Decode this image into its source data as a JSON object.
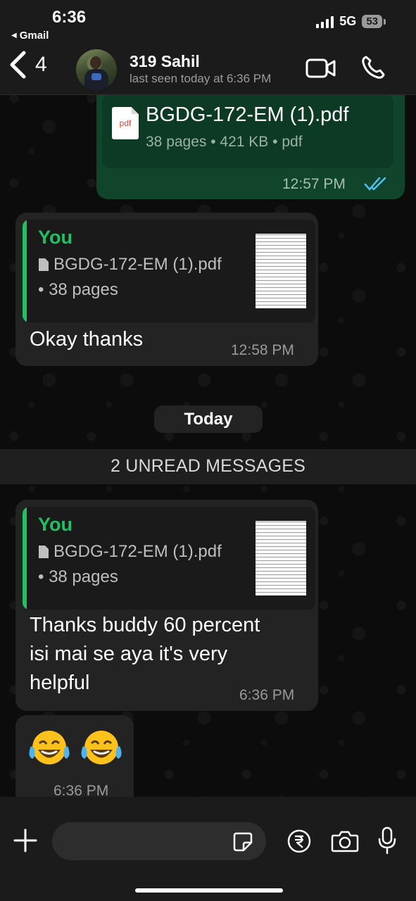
{
  "status_bar": {
    "time": "6:36",
    "back_app": "Gmail",
    "network": "5G",
    "battery": "53"
  },
  "header": {
    "back_count": "4",
    "contact_name": "319 Sahil",
    "contact_status": "last seen today at 6:36 PM",
    "icons": [
      "video-call-icon",
      "phone-call-icon"
    ]
  },
  "messages": {
    "sent_doc": {
      "file_name": "BGDG-172-EM (1).pdf",
      "meta": "38 pages • 421 KB • pdf",
      "pdf_label": "pdf",
      "time": "12:57 PM",
      "ticks": "read"
    },
    "reply1": {
      "quote_author": "You",
      "quote_file": "BGDG-172-EM (1).pdf",
      "quote_pages": "• 38 pages",
      "text": "Okay thanks",
      "time": "12:58 PM"
    },
    "day_separator": "Today",
    "unread_banner": "2 UNREAD MESSAGES",
    "reply2": {
      "quote_author": "You",
      "quote_file": "BGDG-172-EM (1).pdf",
      "quote_pages": "• 38 pages",
      "text_line1": "Thanks buddy 60 percent",
      "text_line2": "isi mai se aya it's very",
      "text_line3": "helpful",
      "time": "6:36 PM"
    },
    "emoji_msg": {
      "emoji": "😂 😂",
      "time": "6:36 PM"
    }
  },
  "composer": {
    "placeholder": "",
    "icons": [
      "plus-icon",
      "sticker-icon",
      "rupee-payment-icon",
      "camera-icon",
      "microphone-icon"
    ]
  },
  "colors": {
    "accent_green": "#21c063",
    "outgoing_bubble": "#10452c",
    "incoming_bubble": "#232323",
    "read_ticks": "#53bdeb"
  }
}
